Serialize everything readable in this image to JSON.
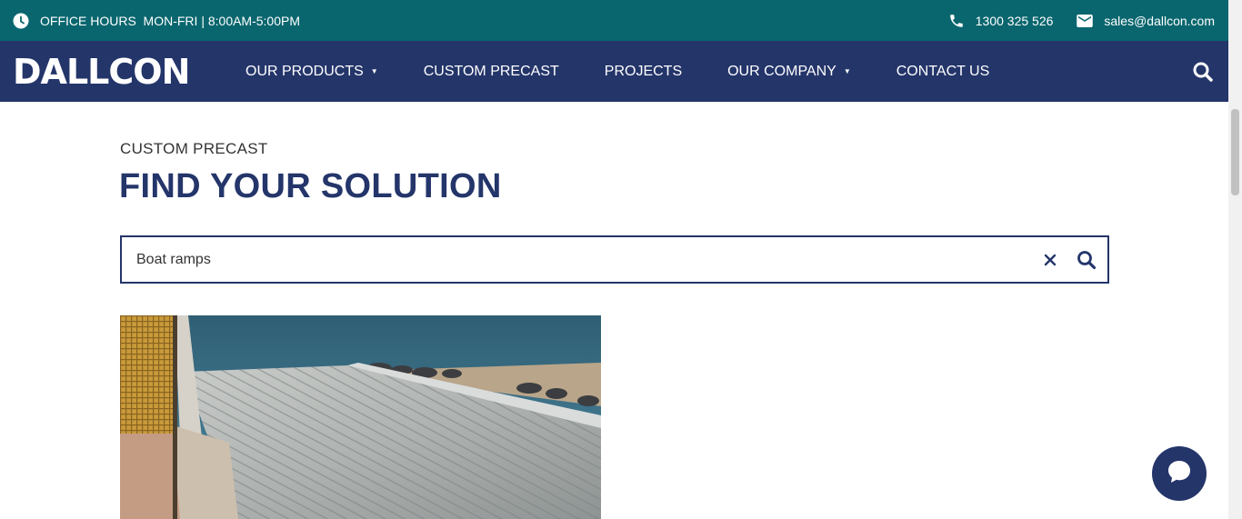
{
  "topbar": {
    "hours_label": "OFFICE HOURS  MON-FRI | 8:00AM-5:00PM",
    "phone": "1300 325 526",
    "email": "sales@dallcon.com"
  },
  "nav": {
    "logo": "DALLCON",
    "items": [
      {
        "label": "OUR PRODUCTS",
        "has_dropdown": true
      },
      {
        "label": "CUSTOM PRECAST",
        "has_dropdown": false
      },
      {
        "label": "PROJECTS",
        "has_dropdown": false
      },
      {
        "label": "OUR COMPANY",
        "has_dropdown": true
      },
      {
        "label": "CONTACT US",
        "has_dropdown": false
      }
    ]
  },
  "page": {
    "eyebrow": "CUSTOM PRECAST",
    "title": "FIND YOUR SOLUTION"
  },
  "search": {
    "value": "Boat ramps"
  },
  "icons": {
    "clock": "clock-icon",
    "phone": "phone-icon",
    "email": "mail-icon",
    "nav_search": "search-icon",
    "clear": "close-icon",
    "submit": "search-icon",
    "chat": "chat-icon"
  },
  "colors": {
    "topbar": "#09666e",
    "navbar": "#24356a",
    "title": "#24356a"
  }
}
